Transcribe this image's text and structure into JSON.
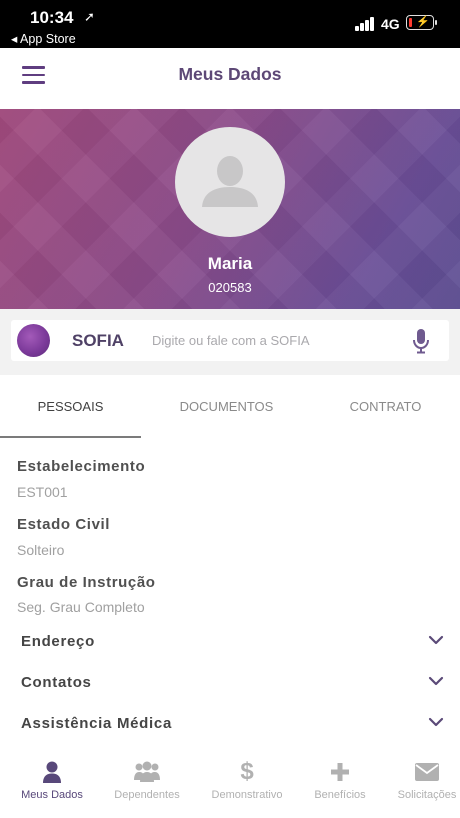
{
  "status_bar": {
    "time": "10:34",
    "location_glyph": "➚",
    "back_label": "◂ App Store",
    "network": "4G",
    "battery_level": 0.15,
    "battery_color": "#ff3b30"
  },
  "header": {
    "title": "Meus Dados",
    "menu_icon": "hamburger-menu-icon"
  },
  "profile": {
    "name": "Maria",
    "id": "020583",
    "avatar_icon": "person-placeholder-icon",
    "banner_colors": [
      "#a24a7d",
      "#6a4e97"
    ]
  },
  "sofia": {
    "label": "SOFIA",
    "placeholder": "Digite ou fale com a SOFIA",
    "mic_icon": "microphone-icon"
  },
  "tabs": [
    {
      "label": "PESSOAIS",
      "active": true
    },
    {
      "label": "DOCUMENTOS",
      "active": false
    },
    {
      "label": "CONTRATO",
      "active": false
    }
  ],
  "fields": [
    {
      "label": "Estabelecimento",
      "value": "EST001"
    },
    {
      "label": "Estado Civil",
      "value": "Solteiro"
    },
    {
      "label": "Grau de Instrução",
      "value": "Seg. Grau Completo"
    }
  ],
  "sections": [
    {
      "label": "Endereço",
      "icon": "chevron-down-icon"
    },
    {
      "label": "Contatos",
      "icon": "chevron-down-icon"
    },
    {
      "label": "Assistência Médica",
      "icon": "chevron-down-icon"
    }
  ],
  "bottom_nav": [
    {
      "label": "Meus Dados",
      "icon": "person-icon",
      "active": true
    },
    {
      "label": "Dependentes",
      "icon": "group-icon",
      "active": false
    },
    {
      "label": "Demonstrativo",
      "icon": "dollar-icon",
      "active": false
    },
    {
      "label": "Benefícios",
      "icon": "plus-icon",
      "active": false
    },
    {
      "label": "Solicitações",
      "icon": "envelope-icon",
      "active": false
    }
  ],
  "colors": {
    "accent": "#5d4876",
    "active_nav": "#58487a",
    "inactive_nav": "#b1b1b1"
  }
}
